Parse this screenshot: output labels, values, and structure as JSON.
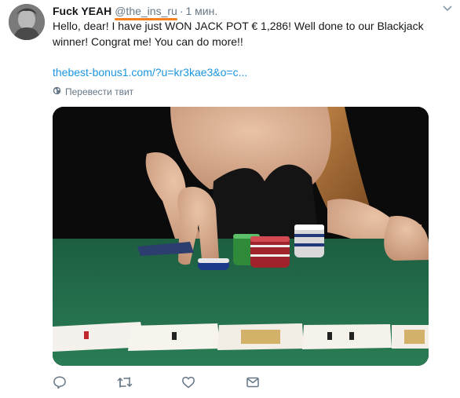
{
  "tweet": {
    "display_name": "Fuck YEAH",
    "handle": "@the_ins_ru",
    "separator": "·",
    "time": "1 мин.",
    "text": "Hello, dear! I have just WON JACK POT € 1,286! Well done to our Blackjack winner! Congrat me! You can do more!!",
    "link": "thebest-bonus1.com/?u=kr3kae3&o=c...",
    "translate_label": "Перевести твит"
  },
  "icons": {
    "reply": "reply-icon",
    "retweet": "retweet-icon",
    "like": "like-icon",
    "message": "message-icon",
    "globe": "globe-icon",
    "caret": "chevron-down-icon"
  },
  "colors": {
    "link": "#1b95e0",
    "secondary": "#657786",
    "underline": "#f4801f",
    "table_felt": "#1f6e4a"
  }
}
